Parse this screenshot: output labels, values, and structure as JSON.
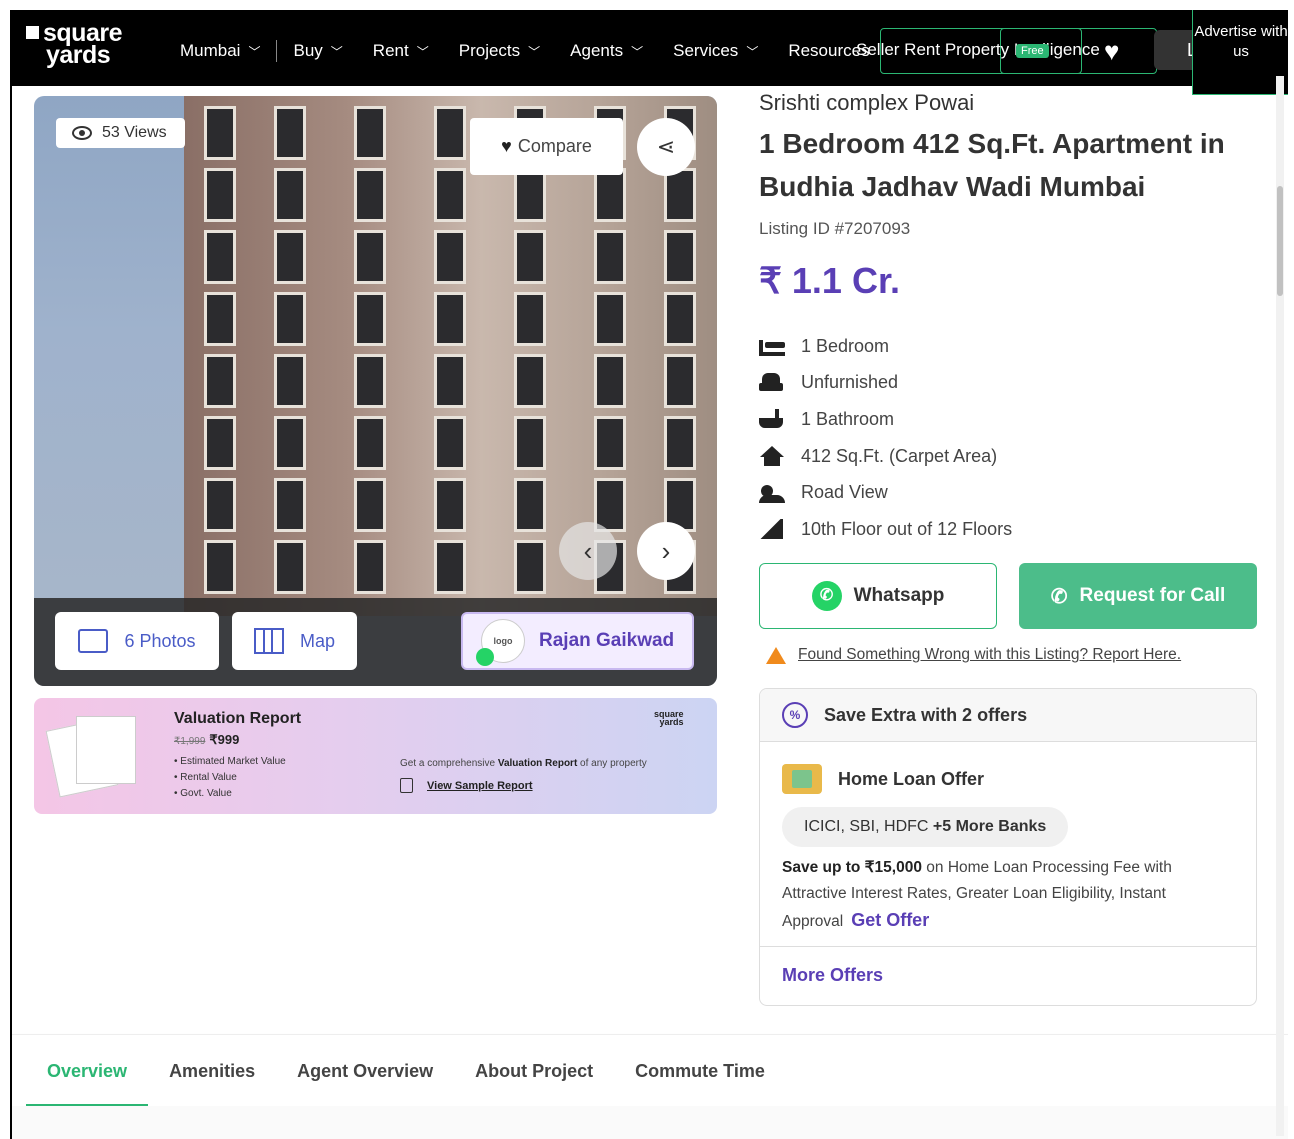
{
  "header": {
    "logo_line1": "square",
    "logo_line2": "yards",
    "city": "Mumbai",
    "nav": [
      "Buy",
      "Rent",
      "Projects",
      "Agents",
      "Services",
      "Resources"
    ],
    "seller_text": "Seller Rent Property Intelligence",
    "free_badge": "Free",
    "login": "Login",
    "advertise": "Advertise with us"
  },
  "gallery": {
    "views": "53 Views",
    "compare": "Compare",
    "photos": "6 Photos",
    "map": "Map",
    "agent_name": "Rajan Gaikwad",
    "agent_avatar_text": "logo"
  },
  "valuation": {
    "title": "Valuation Report",
    "old_price": "₹1,999",
    "new_price": "₹999",
    "items": [
      "Estimated Market Value",
      "Rental Value",
      "Govt. Value"
    ],
    "desc_pre": "Get a comprehensive ",
    "desc_bold": "Valuation Report",
    "desc_post": " of any property",
    "sample": "View Sample Report",
    "logo_l1": "square",
    "logo_l2": "yards"
  },
  "listing": {
    "project": "Srishti complex Powai",
    "title": "1 Bedroom 412 Sq.Ft. Apartment in Budhia Jadhav Wadi Mumbai",
    "listing_id": "Listing ID #7207093",
    "price": "₹ 1.1 Cr.",
    "features": [
      {
        "icon": "bed-icon",
        "text": "1 Bedroom"
      },
      {
        "icon": "sofa-icon",
        "text": "Unfurnished"
      },
      {
        "icon": "bathtub-icon",
        "text": "1 Bathroom"
      },
      {
        "icon": "home-icon",
        "text": "412 Sq.Ft. (Carpet Area)"
      },
      {
        "icon": "view-icon",
        "text": "Road View"
      },
      {
        "icon": "stairs-icon",
        "text": "10th Floor out of 12 Floors"
      }
    ],
    "whatsapp": "Whatsapp",
    "request_call": "Request for Call",
    "report": "Found Something Wrong with this Listing? Report Here."
  },
  "offers": {
    "header": "Save Extra with 2 offers",
    "home_loan_title": "Home Loan Offer",
    "banks_plain": "ICICI, SBI, HDFC ",
    "banks_bold": "+5 More Banks",
    "desc_bold": "Save up to ₹15,000",
    "desc_rest": " on Home Loan Processing Fee with Attractive Interest Rates, Greater Loan Eligibility, Instant Approval",
    "get_offer": "Get Offer",
    "more_offers": "More Offers"
  },
  "tabs": [
    "Overview",
    "Amenities",
    "Agent Overview",
    "About Project",
    "Commute Time"
  ],
  "colors": {
    "accent_green": "#2bb673",
    "accent_purple": "#5a3fb5",
    "call_button": "#4cbd8a",
    "header_bg": "#000000"
  }
}
